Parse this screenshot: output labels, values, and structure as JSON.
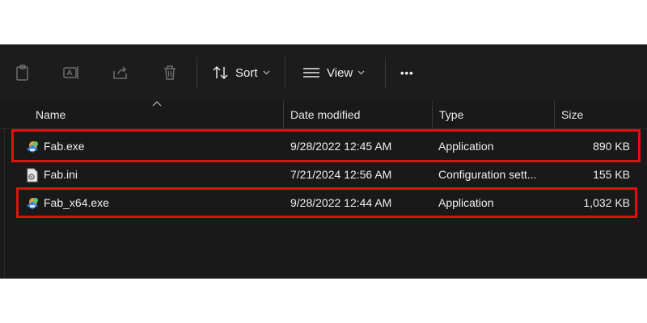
{
  "toolbar": {
    "icons": [
      "paste-icon",
      "rename-icon",
      "share-icon",
      "delete-icon"
    ],
    "sort_label": "Sort",
    "view_label": "View",
    "more_label": "•••"
  },
  "columns": {
    "name": "Name",
    "date": "Date modified",
    "type": "Type",
    "size": "Size"
  },
  "files": [
    {
      "name": "Fab.exe",
      "date": "9/28/2022 12:45 AM",
      "type": "Application",
      "size": "890 KB",
      "icon": "application-icon",
      "highlighted": true
    },
    {
      "name": "Fab.ini",
      "date": "7/21/2024 12:56 AM",
      "type": "Configuration sett...",
      "size": "155 KB",
      "icon": "settings-file-icon",
      "highlighted": false
    },
    {
      "name": "Fab_x64.exe",
      "date": "9/28/2022 12:44 AM",
      "type": "Application",
      "size": "1,032 KB",
      "icon": "application-icon",
      "highlighted": true
    }
  ],
  "colors": {
    "background": "#191919",
    "text": "#f0f0f0",
    "highlight": "#e01010"
  }
}
